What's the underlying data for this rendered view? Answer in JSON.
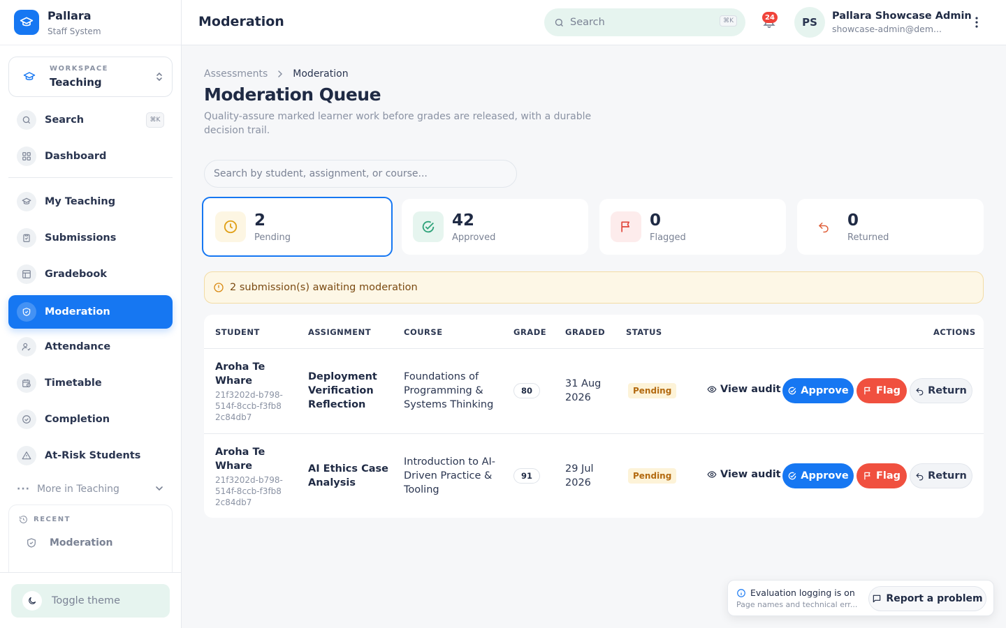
{
  "brand": {
    "name": "Pallara",
    "subtitle": "Staff System",
    "accent": "#1677f2"
  },
  "workspace": {
    "label": "WORKSPACE",
    "name": "Teaching"
  },
  "sidebar": {
    "search_label": "Search",
    "search_shortcut": "⌘K",
    "items": [
      {
        "label": "Dashboard",
        "icon": "grid-icon"
      },
      {
        "label": "My Teaching",
        "icon": "graduation-cap-icon"
      },
      {
        "label": "Submissions",
        "icon": "clipboard-icon"
      },
      {
        "label": "Gradebook",
        "icon": "table-icon"
      },
      {
        "label": "Moderation",
        "icon": "shield-check-icon",
        "active": true
      },
      {
        "label": "Attendance",
        "icon": "user-check-icon"
      },
      {
        "label": "Timetable",
        "icon": "calendar-clock-icon"
      },
      {
        "label": "Completion",
        "icon": "check-circle-icon"
      },
      {
        "label": "At-Risk Students",
        "icon": "warning-triangle-icon"
      }
    ],
    "more_label": "More in Teaching",
    "recent_title": "RECENT",
    "recent_items": [
      {
        "label": "Moderation",
        "icon": "shield-icon"
      }
    ],
    "toggle_theme": "Toggle theme"
  },
  "header": {
    "title": "Moderation",
    "search_placeholder": "Search",
    "search_shortcut": "⌘K",
    "notification_count": "24",
    "user_initials": "PS",
    "user_name": "Pallara Showcase Admin",
    "user_email": "showcase-admin@dem..."
  },
  "breadcrumb": {
    "parent": "Assessments",
    "current": "Moderation"
  },
  "page": {
    "title": "Moderation Queue",
    "subtitle": "Quality-assure marked learner work before grades are released, with a durable decision trail.",
    "filter_placeholder": "Search by student, assignment, or course..."
  },
  "stats": [
    {
      "value": "2",
      "label": "Pending",
      "color": "#e0a017",
      "bg": "#fdf6e3",
      "icon": "clock-icon"
    },
    {
      "value": "42",
      "label": "Approved",
      "color": "#2fa37a",
      "bg": "#e6f5ef",
      "icon": "check-circle-icon"
    },
    {
      "value": "0",
      "label": "Flagged",
      "color": "#e0453a",
      "bg": "#fdecec",
      "icon": "flag-icon"
    },
    {
      "value": "0",
      "label": "Returned",
      "color": "#e0603a",
      "bg": "#ffffff",
      "icon": "undo-icon"
    }
  ],
  "alert": {
    "text": "2 submission(s) awaiting moderation"
  },
  "table": {
    "headers": [
      "STUDENT",
      "ASSIGNMENT",
      "COURSE",
      "GRADE",
      "GRADED",
      "STATUS",
      "ACTIONS"
    ],
    "rows": [
      {
        "student": "Aroha Te Whare",
        "student_id": "21f3202d-b798-514f-8ccb-f3fb82c84db7",
        "assignment": "Deployment Verification Reflection",
        "course": "Foundations of Programming & Systems Thinking",
        "grade": "80",
        "graded": "31 Aug 2026",
        "status": "Pending"
      },
      {
        "student": "Aroha Te Whare",
        "student_id": "21f3202d-b798-514f-8ccb-f3fb82c84db7",
        "assignment": "AI Ethics Case Analysis",
        "course": "Introduction to AI-Driven Practice & Tooling",
        "grade": "91",
        "graded": "29 Jul 2026",
        "status": "Pending"
      }
    ],
    "actions": {
      "view_audit": "View audit",
      "approve": "Approve",
      "flag": "Flag",
      "return": "Return"
    }
  },
  "toast": {
    "title": "Evaluation logging is on",
    "subtitle": "Page names and technical err...",
    "button": "Report a problem"
  }
}
